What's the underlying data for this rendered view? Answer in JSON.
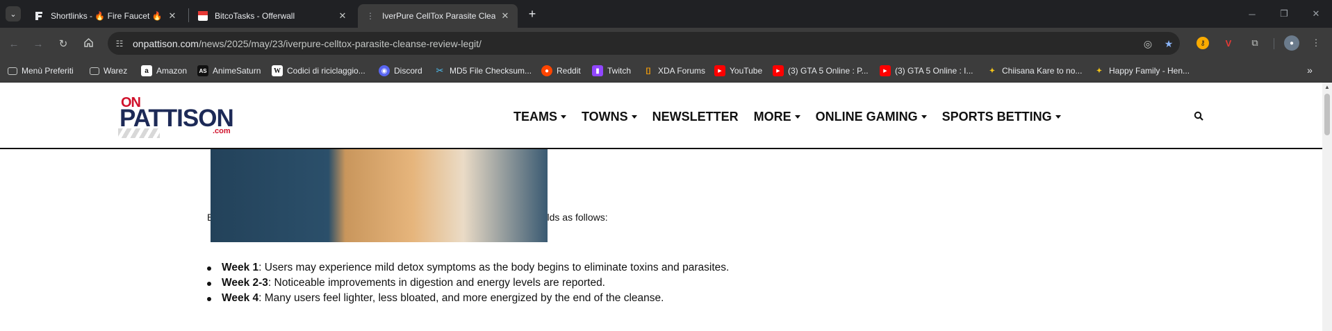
{
  "browser": {
    "tabs": [
      {
        "title": "Shortlinks - 🔥 Fire Faucet 🔥",
        "icon": "fire-faucet-icon",
        "active": false
      },
      {
        "title": "BitcoTasks - Offerwall",
        "icon": "bitcotasks-icon",
        "active": false
      },
      {
        "title": "IverPure CellTox Parasite Cleanse",
        "icon": "loading-icon",
        "active": true
      }
    ],
    "url": {
      "domain": "onpattison.com",
      "path": "/news/2025/may/23/iverpure-celltox-parasite-cleanse-review-legit/"
    },
    "bookmarks": [
      {
        "label": "Menù Preferiti",
        "icon": "folder-icon"
      },
      {
        "label": "Warez",
        "icon": "folder-icon"
      },
      {
        "label": "Amazon",
        "icon": "amazon-icon"
      },
      {
        "label": "AnimeSaturn",
        "icon": "animesaturn-icon"
      },
      {
        "label": "Codici di riciclaggio...",
        "icon": "wikipedia-icon"
      },
      {
        "label": "Discord",
        "icon": "discord-icon"
      },
      {
        "label": "MD5 File Checksum...",
        "icon": "md5-icon"
      },
      {
        "label": "Reddit",
        "icon": "reddit-icon"
      },
      {
        "label": "Twitch",
        "icon": "twitch-icon"
      },
      {
        "label": "XDA Forums",
        "icon": "xda-icon"
      },
      {
        "label": "YouTube",
        "icon": "youtube-icon"
      },
      {
        "label": "(3) GTA 5 Online : P...",
        "icon": "youtube-icon"
      },
      {
        "label": "(3) GTA 5 Online : I...",
        "icon": "youtube-icon"
      },
      {
        "label": "Chiisana Kare to no...",
        "icon": "hentai-site-icon"
      },
      {
        "label": "Happy Family - Hen...",
        "icon": "hentai-site-icon"
      }
    ]
  },
  "site": {
    "logo": {
      "on": "ON",
      "main": "PATTISON",
      "com": ".com"
    },
    "nav": [
      {
        "label": "TEAMS",
        "dropdown": true
      },
      {
        "label": "TOWNS",
        "dropdown": true
      },
      {
        "label": "NEWSLETTER",
        "dropdown": false
      },
      {
        "label": "MORE",
        "dropdown": true
      },
      {
        "label": "ONLINE GAMING",
        "dropdown": true
      },
      {
        "label": "SPORTS BETTING",
        "dropdown": true
      }
    ]
  },
  "article": {
    "intro": "Based on customer feedback, the typical experience with CellTox Cleanse unfolds as follows:",
    "timeline": [
      {
        "label": "Week 1",
        "text": ": Users may experience mild detox symptoms as the body begins to eliminate toxins and parasites."
      },
      {
        "label": "Week 2-3",
        "text": ": Noticeable improvements in digestion and energy levels are reported."
      },
      {
        "label": "Week 4",
        "text": ": Many users feel lighter, less bloated, and more energized by the end of the cleanse."
      }
    ]
  }
}
